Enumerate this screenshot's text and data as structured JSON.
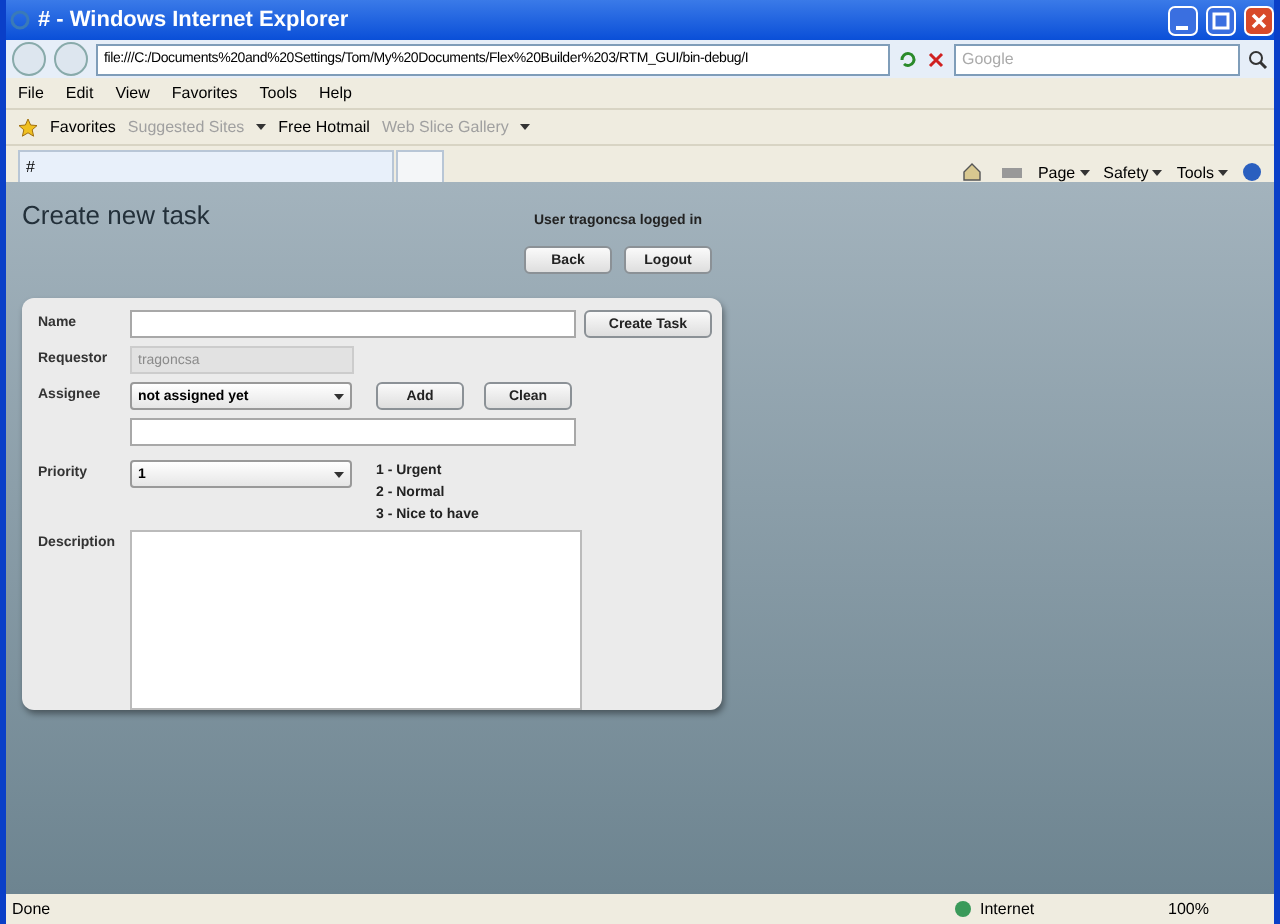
{
  "window": {
    "title": "# - Windows Internet Explorer"
  },
  "address_bar": {
    "url": "file:///C:/Documents%20and%20Settings/Tom/My%20Documents/Flex%20Builder%203/RTM_GUI/bin-debug/I",
    "search_placeholder": "Google"
  },
  "menu": [
    "File",
    "Edit",
    "View",
    "Favorites",
    "Tools",
    "Help"
  ],
  "favorites_bar": {
    "label": "Favorites",
    "items": [
      {
        "label": "Suggested Sites",
        "disabled": true,
        "has_menu": true
      },
      {
        "label": "Free Hotmail",
        "disabled": false,
        "has_menu": false
      },
      {
        "label": "Web Slice Gallery",
        "disabled": true,
        "has_menu": true
      }
    ]
  },
  "tabs": [
    {
      "label": "#",
      "selected": true
    },
    {
      "selected": false
    }
  ],
  "command_bar": [
    "Page",
    "Safety",
    "Tools"
  ],
  "page": {
    "title": "Create new task",
    "user_status": "User tragoncsa logged in",
    "buttons": [
      "Back",
      "Logout"
    ],
    "form": {
      "name": {
        "label": "Name"
      },
      "create_button": "Create Task",
      "requestor": {
        "label": "Requestor",
        "value": "tragoncsa",
        "disabled": true
      },
      "assignee": {
        "label": "Assignee",
        "value": "not assigned yet"
      },
      "assignee_buttons": [
        "Add",
        "Clean"
      ],
      "priority": {
        "label": "Priority",
        "value": "1"
      },
      "priority_legend": [
        "1 - Urgent",
        "2 - Normal",
        "3 - Nice to have"
      ],
      "description": {
        "label": "Description"
      }
    }
  },
  "status_bar": {
    "status": "Done",
    "zone": "Internet",
    "zoom": "100%"
  }
}
